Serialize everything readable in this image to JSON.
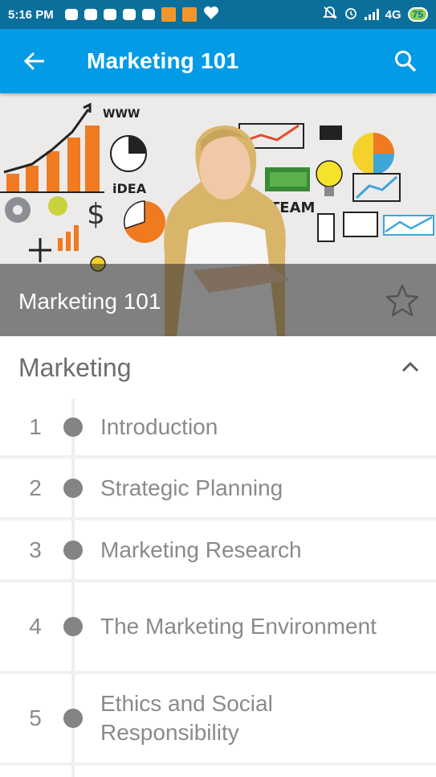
{
  "status_bar": {
    "time": "5:16 PM",
    "network": "4G",
    "battery": "75"
  },
  "app_bar": {
    "title": "Marketing 101"
  },
  "hero": {
    "title": "Marketing 101"
  },
  "section": {
    "title": "Marketing"
  },
  "lessons": [
    {
      "number": "1",
      "title": "Introduction"
    },
    {
      "number": "2",
      "title": "Strategic Planning"
    },
    {
      "number": "3",
      "title": "Marketing Research"
    },
    {
      "number": "4",
      "title": "The Marketing Environment"
    },
    {
      "number": "5",
      "title": "Ethics and Social Responsibility"
    }
  ],
  "colors": {
    "status_bar": "#0b6f9c",
    "app_bar": "#039be5",
    "text_gray": "#8a8a8a"
  }
}
